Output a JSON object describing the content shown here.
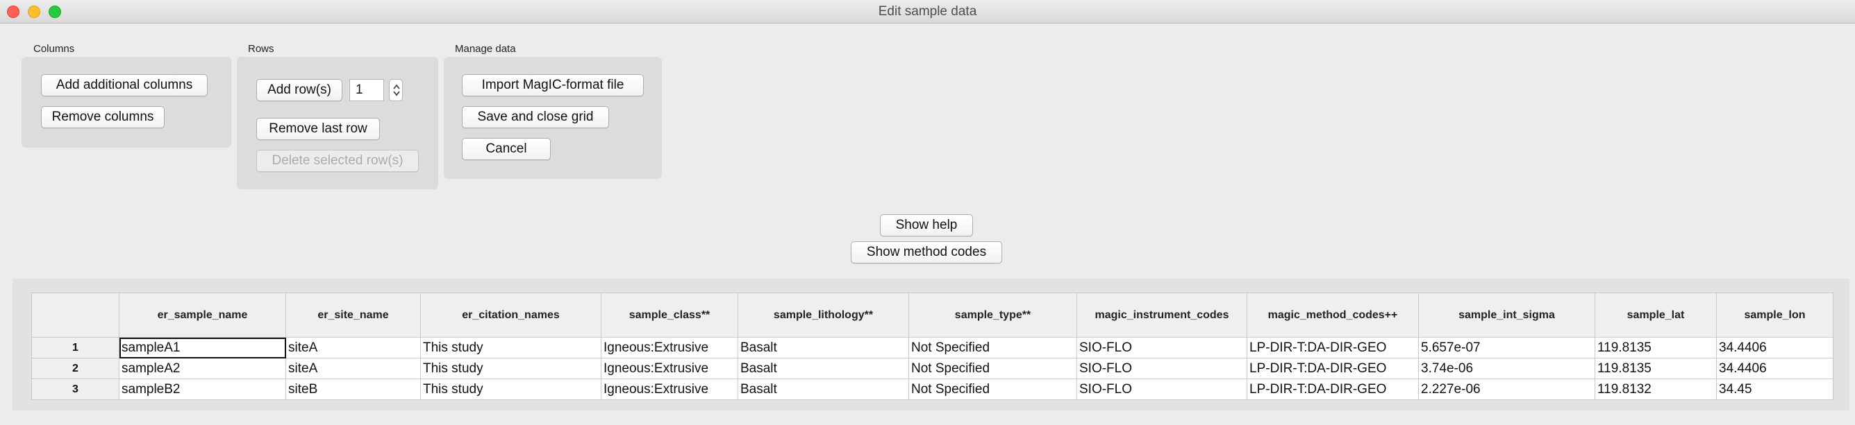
{
  "window": {
    "title": "Edit sample data"
  },
  "columns_group": {
    "label": "Columns",
    "add_button": "Add additional columns",
    "remove_button": "Remove columns"
  },
  "rows_group": {
    "label": "Rows",
    "add_button": "Add row(s)",
    "row_count": "1",
    "remove_last_button": "Remove last row",
    "delete_selected_button": "Delete selected row(s)"
  },
  "manage_group": {
    "label": "Manage data",
    "import_button": "Import MagIC-format file",
    "save_button": "Save and close grid",
    "cancel_button": "Cancel"
  },
  "help": {
    "show_help": "Show help",
    "show_method_codes": "Show method codes"
  },
  "grid": {
    "headers": [
      "er_sample_name",
      "er_site_name",
      "er_citation_names",
      "sample_class**",
      "sample_lithology**",
      "sample_type**",
      "magic_instrument_codes",
      "magic_method_codes++",
      "sample_int_sigma",
      "sample_lat",
      "sample_lon"
    ],
    "rows": [
      {
        "label": "1",
        "cells": [
          "sampleA1",
          "siteA",
          "This study",
          "Igneous:Extrusive",
          "Basalt",
          "Not Specified",
          "SIO-FLO",
          "LP-DIR-T:DA-DIR-GEO",
          "5.657e-07",
          "119.8135",
          "34.4406"
        ]
      },
      {
        "label": "2",
        "cells": [
          "sampleA2",
          "siteA",
          "This study",
          "Igneous:Extrusive",
          "Basalt",
          "Not Specified",
          "SIO-FLO",
          "LP-DIR-T:DA-DIR-GEO",
          "3.74e-06",
          "119.8135",
          "34.4406"
        ]
      },
      {
        "label": "3",
        "cells": [
          "sampleB2",
          "siteB",
          "This study",
          "Igneous:Extrusive",
          "Basalt",
          "Not Specified",
          "SIO-FLO",
          "LP-DIR-T:DA-DIR-GEO",
          "2.227e-06",
          "119.8132",
          "34.45"
        ]
      }
    ]
  },
  "colors": {
    "window_bg": "#ececec",
    "panel_bg": "#dcdcdc",
    "close": "#fe5f57",
    "minimize": "#febc2e",
    "zoom": "#28c840"
  }
}
